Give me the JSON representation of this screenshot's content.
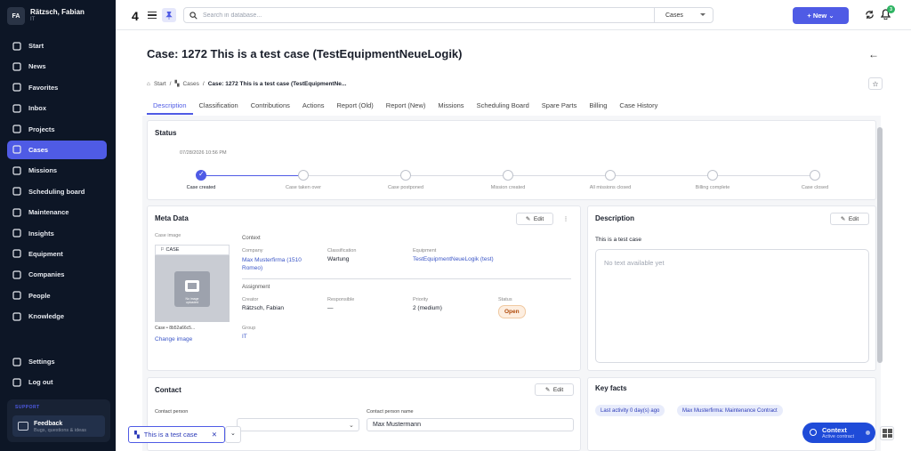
{
  "user": {
    "initials": "FA",
    "name": "Rätzsch, Fabian",
    "dept": "IT"
  },
  "nav": [
    {
      "label": "Start",
      "icon": "home-icon"
    },
    {
      "label": "News",
      "icon": "news-icon"
    },
    {
      "label": "Favorites",
      "icon": "star-icon"
    },
    {
      "label": "Inbox",
      "icon": "inbox-icon"
    },
    {
      "label": "Projects",
      "icon": "projects-icon"
    },
    {
      "label": "Cases",
      "icon": "cases-icon"
    },
    {
      "label": "Missions",
      "icon": "missions-icon"
    },
    {
      "label": "Scheduling board",
      "icon": "calendar-icon"
    },
    {
      "label": "Maintenance",
      "icon": "maintenance-icon"
    },
    {
      "label": "Insights",
      "icon": "insights-icon"
    },
    {
      "label": "Equipment",
      "icon": "tools-icon"
    },
    {
      "label": "Companies",
      "icon": "building-icon"
    },
    {
      "label": "People",
      "icon": "people-icon"
    },
    {
      "label": "Knowledge",
      "icon": "book-icon"
    }
  ],
  "nav_bottom": [
    {
      "label": "Settings",
      "icon": "gear-icon"
    },
    {
      "label": "Log out",
      "icon": "logout-icon"
    }
  ],
  "support": {
    "label": "SUPPORT",
    "title": "Feedback",
    "subtitle": "Bugs, questions & ideas"
  },
  "topbar": {
    "search_placeholder": "Search in database...",
    "search_scope": "Cases",
    "new_label": "+  New  ⌄",
    "notif_count": "3"
  },
  "page": {
    "title": "Case: 1272 This is a test case (TestEquipmentNeueLogik)",
    "crumb_start": "Start",
    "crumb_cases": "Cases",
    "crumb_current": "Case: 1272 This is a test case (TestEquipmentNe..."
  },
  "tabs": [
    "Description",
    "Classification",
    "Contributions",
    "Actions",
    "Report (Old)",
    "Report (New)",
    "Missions",
    "Scheduling Board",
    "Spare Parts",
    "Billing",
    "Case History"
  ],
  "status": {
    "title": "Status",
    "date": "07/28/2026 10:56 PM",
    "steps": [
      "Case created",
      "Case taken over",
      "Case postponed",
      "Mission created",
      "All missions closed",
      "Billing complete",
      "Case closed"
    ],
    "completed": 1
  },
  "meta": {
    "title": "Meta Data",
    "edit": "Edit",
    "image_label": "Case image",
    "image_tag": "CASE",
    "image_placeholder": "No image uploaded",
    "case_id": "Case • 8b52a66c5...",
    "change_image": "Change image",
    "context_title": "Context",
    "company_label": "Company",
    "company": "Max Musterfirma (1510 Romeo)",
    "classification_label": "Classification",
    "classification": "Wartung",
    "equipment_label": "Equipment",
    "equipment": "TestEquipmentNeueLogik (test)",
    "assignment_title": "Assignment",
    "creator_label": "Creator",
    "creator": "Rätzsch, Fabian",
    "responsible_label": "Responsible",
    "responsible": "—",
    "priority_label": "Priority",
    "priority": "2 (medium)",
    "status_label": "Status",
    "status": "Open",
    "group_label": "Group",
    "group": "IT"
  },
  "description": {
    "title": "Description",
    "edit": "Edit",
    "text": "This is a test case",
    "placeholder": "No text available yet"
  },
  "contact": {
    "title": "Contact",
    "edit": "Edit",
    "person_label": "Contact person",
    "name_label": "Contact person name",
    "name": "Max Mustermann"
  },
  "keyfacts": {
    "title": "Key facts",
    "items": [
      "Last activity 0 day(s) ago",
      "Max Musterfirma: Maintenance Contract"
    ]
  },
  "chip": {
    "label": "This is a test case"
  },
  "context_btn": {
    "title": "Context",
    "subtitle": "Active contract"
  },
  "colors": {
    "accent": "#4f5be5",
    "sidebar": "#0d1626",
    "open_badge": "#fdeee0"
  }
}
